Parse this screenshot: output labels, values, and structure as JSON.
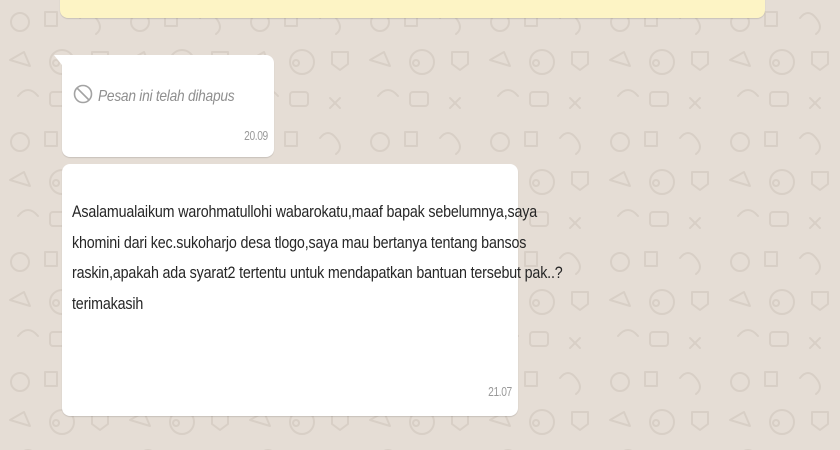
{
  "chat": {
    "deleted_message": {
      "text": "Pesan ini telah dihapus",
      "time": "20.09",
      "icon": "block-icon"
    },
    "incoming_message": {
      "lines": [
        "Asalamualaikum warohmatullohi wabarokatu,maaf bapak sebelumnya,saya",
        "khomini dari kec.sukoharjo desa tlogo,saya mau bertanya tentang bansos",
        "raskin,apakah ada syarat2 tertentu untuk mendapatkan bantuan tersebut pak..?",
        "terimakasih"
      ],
      "time": "21.07"
    }
  },
  "colors": {
    "background": "#e5ddd5",
    "bubble": "#ffffff",
    "banner": "#fdf4c5",
    "meta_text": "#9a9a9a"
  }
}
